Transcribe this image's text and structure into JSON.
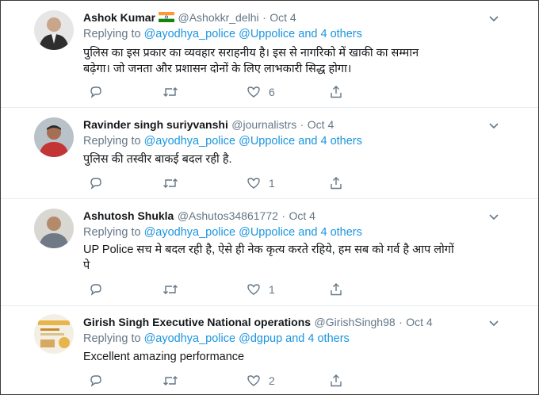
{
  "replying_label": "Replying to",
  "tweets": [
    {
      "name": "Ashok Kumar",
      "handle": "@Ashokkr_delhi",
      "separator": "·",
      "date": "Oct 4",
      "mentions": "@ayodhya_police @Uppolice and 4 others",
      "text_line1": "पुलिस का इस प्रकार का व्यवहार सराहनीय है। इस से नागरिको में खाकी का सम्मान",
      "text_line2": "बढ़ेगा। जो जनता और प्रशासन दोनों के लिए लाभकारी सिद्ध होगा।",
      "likes": "6",
      "avatar_colors": {
        "bg": "#e6e6e6",
        "face": "#c9a58a",
        "suit": "#2e2e2e"
      }
    },
    {
      "name": "Ravinder singh suriyvanshi",
      "handle": "@journalistrs",
      "separator": "·",
      "date": "Oct 4",
      "mentions": "@ayodhya_police @Uppolice and 4 others",
      "text_line1": "पुलिस की तस्वीर बाकई बदल रही है.",
      "likes": "1",
      "avatar_colors": {
        "bg": "#b9c2c9",
        "face": "#a66e52",
        "suit": "#c33434"
      }
    },
    {
      "name": "Ashutosh Shukla",
      "handle": "@Ashutos34861772",
      "separator": "·",
      "date": "Oct 4",
      "mentions": "@ayodhya_police @Uppolice and 4 others",
      "text_line1": "UP Police सच मे बदल रही है, ऐसे ही नेक कृत्य करते रहिये, हम सब को गर्व है आप लोगों",
      "text_line2": "पे",
      "likes": "1",
      "avatar_colors": {
        "bg": "#d9d7d2",
        "face": "#b58a6c",
        "suit": "#6f7a86"
      }
    },
    {
      "name": "Girish Singh Executive National operations",
      "handle": "@GirishSingh98",
      "separator": "·",
      "date": "Oct 4",
      "mentions": "@ayodhya_police @dgpup and 4 others",
      "text_line1": "Excellent amazing performance",
      "likes": "2",
      "avatar_colors": {
        "bg": "#f4efe4",
        "face": "#e8b54a",
        "suit": "#c98a2a"
      }
    }
  ],
  "colors": {
    "link": "#1b95e0",
    "muted": "#657786",
    "text": "#14171a",
    "divider": "#e6ecf0",
    "flag_saffron": "#ff9933",
    "flag_green": "#138808",
    "chakra": "#000080"
  },
  "icons": {
    "reply": "reply-icon",
    "retweet": "retweet-icon",
    "like": "heart-icon",
    "share": "share-icon",
    "caret": "chevron-down-icon",
    "flag": "india-flag-icon"
  }
}
